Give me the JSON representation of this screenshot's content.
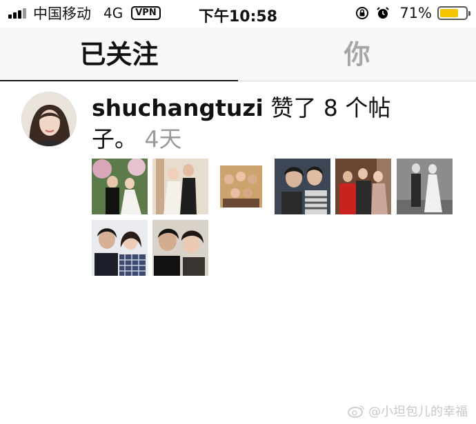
{
  "status_bar": {
    "carrier": "中国移动",
    "network": "4G",
    "vpn": "VPN",
    "time": "下午10:58",
    "battery_percent": "71%",
    "battery_level": 0.71,
    "battery_color": "#f5c400",
    "icons": [
      "signal-icon",
      "rotation-lock-icon",
      "alarm-icon",
      "battery-icon"
    ]
  },
  "tabs": [
    {
      "label": "已关注",
      "active": true
    },
    {
      "label": "你",
      "active": false
    }
  ],
  "activity": {
    "username": "shuchangtuzi",
    "action": " 赞了 8 个帖子。",
    "time": "4天",
    "liked_post_count": 8
  },
  "watermark": {
    "text": "@小坦包儿的幸福",
    "icon": "weibo-icon"
  }
}
